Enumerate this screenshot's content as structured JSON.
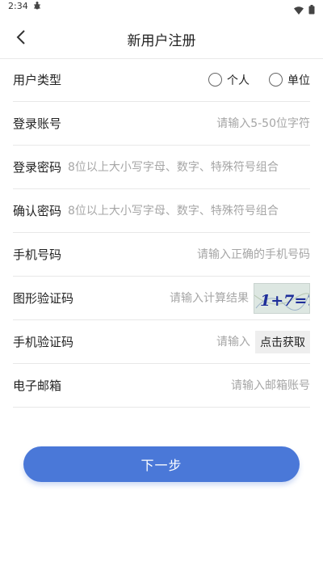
{
  "status_bar": {
    "time": "2:34",
    "notification_icon": "bug-icon",
    "icons": [
      "wifi-icon",
      "battery-icon"
    ]
  },
  "header": {
    "back_icon": "chevron-left-icon",
    "title": "新用户注册"
  },
  "form": {
    "user_type": {
      "label": "用户类型",
      "options": [
        {
          "label": "个人",
          "selected": false
        },
        {
          "label": "单位",
          "selected": false
        }
      ]
    },
    "account": {
      "label": "登录账号",
      "value": "",
      "placeholder": "请输入5-50位字符"
    },
    "password": {
      "label": "登录密码",
      "value": "",
      "placeholder": "8位以上大小写字母、数字、特殊符号组合"
    },
    "confirm_password": {
      "label": "确认密码",
      "value": "",
      "placeholder": "8位以上大小写字母、数字、特殊符号组合"
    },
    "phone": {
      "label": "手机号码",
      "value": "",
      "placeholder": "请输入正确的手机号码"
    },
    "captcha": {
      "label": "图形验证码",
      "value": "",
      "placeholder": "请输入计算结果",
      "image_text": "1+7=?"
    },
    "sms_code": {
      "label": "手机验证码",
      "value": "",
      "placeholder": "请输入",
      "button_label": "点击获取"
    },
    "email": {
      "label": "电子邮箱",
      "value": "",
      "placeholder": "请输入邮箱账号"
    }
  },
  "next_button": {
    "label": "下一步"
  },
  "colors": {
    "primary": "#4a78d8",
    "divider": "#e8e8e8",
    "placeholder": "#a6a6a6"
  }
}
